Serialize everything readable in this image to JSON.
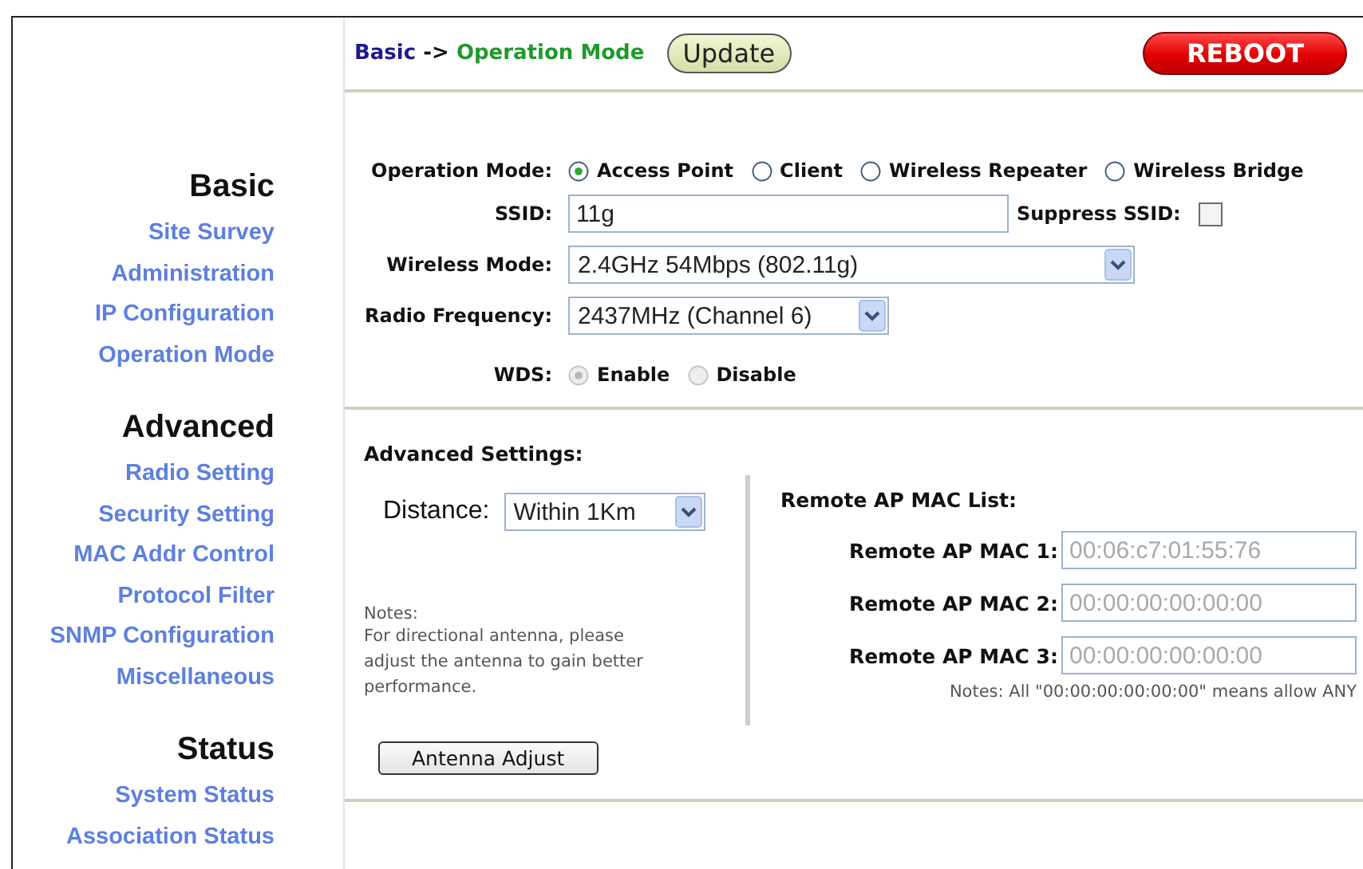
{
  "breadcrumb": {
    "section": "Basic",
    "arrow": "->",
    "page": "Operation Mode"
  },
  "update_button": "Update",
  "reboot_button": "REBOOT",
  "sidebar": {
    "groups": [
      {
        "title": "Basic",
        "items": [
          {
            "label": "Site Survey"
          },
          {
            "label": "Administration"
          },
          {
            "label": "IP Configuration"
          },
          {
            "label": "Operation Mode"
          }
        ]
      },
      {
        "title": "Advanced",
        "items": [
          {
            "label": "Radio Setting"
          },
          {
            "label": "Security Setting"
          },
          {
            "label": "MAC Addr Control"
          },
          {
            "label": "Protocol Filter"
          },
          {
            "label": "SNMP Configuration"
          },
          {
            "label": "Miscellaneous"
          }
        ]
      },
      {
        "title": "Status",
        "items": [
          {
            "label": "System Status"
          },
          {
            "label": "Association Status"
          }
        ]
      }
    ]
  },
  "operation_mode": {
    "label": "Operation Mode:",
    "options": [
      {
        "label": "Access Point",
        "selected": true
      },
      {
        "label": "Client",
        "selected": false
      },
      {
        "label": "Wireless Repeater",
        "selected": false
      },
      {
        "label": "Wireless Bridge",
        "selected": false
      }
    ]
  },
  "ssid": {
    "label": "SSID:",
    "value": "11g"
  },
  "suppress_ssid": {
    "label": "Suppress SSID:",
    "checked": false
  },
  "wireless_mode": {
    "label": "Wireless Mode:",
    "value": "2.4GHz 54Mbps (802.11g)"
  },
  "radio_frequency": {
    "label": "Radio Frequency:",
    "value": "2437MHz (Channel 6)"
  },
  "wds": {
    "label": "WDS:",
    "disabled": true,
    "options": [
      {
        "label": "Enable",
        "selected": true
      },
      {
        "label": "Disable",
        "selected": false
      }
    ]
  },
  "advanced_settings": {
    "title": "Advanced Settings:",
    "distance": {
      "label": "Distance:",
      "value": "Within 1Km"
    },
    "notes_title": "Notes:",
    "notes_text": "For directional antenna, please adjust the antenna to gain better performance.",
    "antenna_button": "Antenna Adjust"
  },
  "remote_ap_mac_list": {
    "title": "Remote AP MAC List:",
    "disabled": true,
    "entries": [
      {
        "label": "Remote AP MAC 1:",
        "value": "00:06:c7:01:55:76"
      },
      {
        "label": "Remote AP MAC 2:",
        "value": "00:00:00:00:00:00"
      },
      {
        "label": "Remote AP MAC 3:",
        "value": "00:00:00:00:00:00"
      }
    ],
    "note": "Notes: All \"00:00:00:00:00:00\" means allow ANY"
  }
}
